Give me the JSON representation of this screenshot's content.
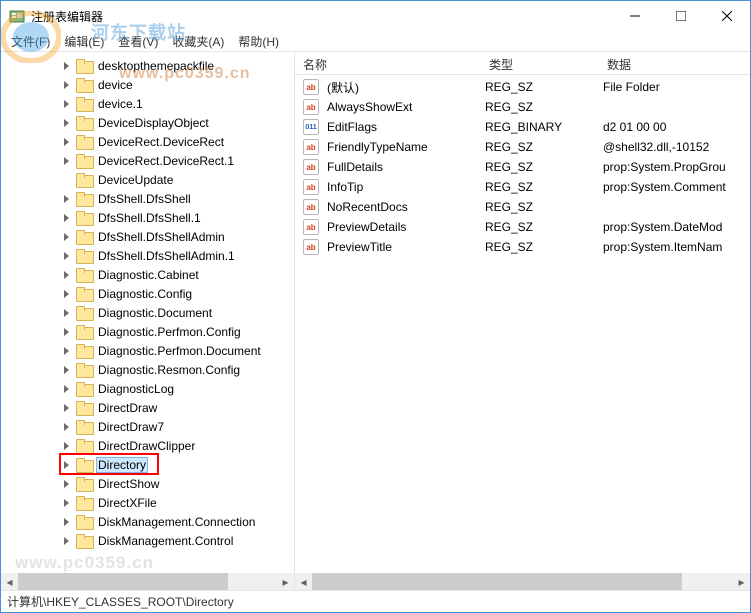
{
  "window": {
    "title": "注册表编辑器"
  },
  "menu": {
    "file": "文件(F)",
    "edit": "编辑(E)",
    "view": "查看(V)",
    "favorites": "收藏夹(A)",
    "help": "帮助(H)"
  },
  "tree": {
    "items": [
      {
        "label": "desktopthemepackfile",
        "depth": 3,
        "exp": true
      },
      {
        "label": "device",
        "depth": 3,
        "exp": true
      },
      {
        "label": "device.1",
        "depth": 3,
        "exp": true
      },
      {
        "label": "DeviceDisplayObject",
        "depth": 3,
        "exp": true
      },
      {
        "label": "DeviceRect.DeviceRect",
        "depth": 3,
        "exp": true
      },
      {
        "label": "DeviceRect.DeviceRect.1",
        "depth": 3,
        "exp": true
      },
      {
        "label": "DeviceUpdate",
        "depth": 3,
        "exp": false
      },
      {
        "label": "DfsShell.DfsShell",
        "depth": 3,
        "exp": true
      },
      {
        "label": "DfsShell.DfsShell.1",
        "depth": 3,
        "exp": true
      },
      {
        "label": "DfsShell.DfsShellAdmin",
        "depth": 3,
        "exp": true
      },
      {
        "label": "DfsShell.DfsShellAdmin.1",
        "depth": 3,
        "exp": true
      },
      {
        "label": "Diagnostic.Cabinet",
        "depth": 3,
        "exp": true
      },
      {
        "label": "Diagnostic.Config",
        "depth": 3,
        "exp": true
      },
      {
        "label": "Diagnostic.Document",
        "depth": 3,
        "exp": true
      },
      {
        "label": "Diagnostic.Perfmon.Config",
        "depth": 3,
        "exp": true
      },
      {
        "label": "Diagnostic.Perfmon.Document",
        "depth": 3,
        "exp": true
      },
      {
        "label": "Diagnostic.Resmon.Config",
        "depth": 3,
        "exp": true
      },
      {
        "label": "DiagnosticLog",
        "depth": 3,
        "exp": true
      },
      {
        "label": "DirectDraw",
        "depth": 3,
        "exp": true
      },
      {
        "label": "DirectDraw7",
        "depth": 3,
        "exp": true
      },
      {
        "label": "DirectDrawClipper",
        "depth": 3,
        "exp": true
      },
      {
        "label": "Directory",
        "depth": 3,
        "exp": true,
        "selected": true,
        "highlight": true
      },
      {
        "label": "DirectShow",
        "depth": 3,
        "exp": true
      },
      {
        "label": "DirectXFile",
        "depth": 3,
        "exp": true
      },
      {
        "label": "DiskManagement.Connection",
        "depth": 3,
        "exp": true
      },
      {
        "label": "DiskManagement.Control",
        "depth": 3,
        "exp": true
      }
    ]
  },
  "list": {
    "headers": {
      "name": "名称",
      "type": "类型",
      "data": "数据"
    },
    "col_widths": {
      "name": 186,
      "type": 118,
      "data": 150
    },
    "rows": [
      {
        "icon": "str",
        "name": "(默认)",
        "type": "REG_SZ",
        "data": "File Folder"
      },
      {
        "icon": "str",
        "name": "AlwaysShowExt",
        "type": "REG_SZ",
        "data": ""
      },
      {
        "icon": "bin",
        "name": "EditFlags",
        "type": "REG_BINARY",
        "data": "d2 01 00 00"
      },
      {
        "icon": "str",
        "name": "FriendlyTypeName",
        "type": "REG_SZ",
        "data": "@shell32.dll,-10152"
      },
      {
        "icon": "str",
        "name": "FullDetails",
        "type": "REG_SZ",
        "data": "prop:System.PropGrou"
      },
      {
        "icon": "str",
        "name": "InfoTip",
        "type": "REG_SZ",
        "data": "prop:System.Comment"
      },
      {
        "icon": "str",
        "name": "NoRecentDocs",
        "type": "REG_SZ",
        "data": ""
      },
      {
        "icon": "str",
        "name": "PreviewDetails",
        "type": "REG_SZ",
        "data": "prop:System.DateMod"
      },
      {
        "icon": "str",
        "name": "PreviewTitle",
        "type": "REG_SZ",
        "data": "prop:System.ItemNam"
      }
    ]
  },
  "statusbar": {
    "path": "计算机\\HKEY_CLASSES_ROOT\\Directory"
  },
  "watermark": {
    "top_text": "河东下载站",
    "mid_text": "www.pc0359.cn",
    "bot_text": "www.pc0359.cn"
  }
}
